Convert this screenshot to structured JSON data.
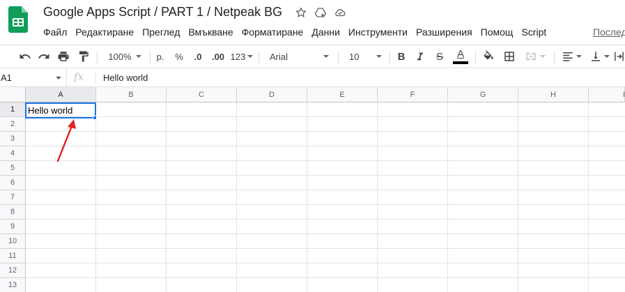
{
  "document": {
    "title": "Google Apps Script / PART 1 / Netpeak BG"
  },
  "menu": {
    "items": [
      "Файл",
      "Редактиране",
      "Преглед",
      "Вмъкване",
      "Форматиране",
      "Данни",
      "Инструменти",
      "Разширения",
      "Помощ",
      "Script"
    ],
    "last_edit": "Послед"
  },
  "toolbar": {
    "zoom": "100%",
    "currency": "р.",
    "percent": "%",
    "decrease_decimal": ".0",
    "increase_decimal": ".00",
    "more_formats": "123",
    "font": "Arial",
    "font_size": "10",
    "bold": "B",
    "strike": "S",
    "text_color": "A"
  },
  "formula_bar": {
    "name_box": "A1",
    "fx": "fx",
    "value": "Hello world"
  },
  "grid": {
    "columns": [
      "A",
      "B",
      "C",
      "D",
      "E",
      "F",
      "G",
      "H",
      "I"
    ],
    "rows": [
      "1",
      "2",
      "3",
      "4",
      "5",
      "6",
      "7",
      "8",
      "9",
      "10",
      "11",
      "12",
      "13"
    ],
    "cell_a1": "Hello world"
  },
  "colors": {
    "selection": "#1a73e8",
    "arrow": "#e02424",
    "sheets_green": "#0f9d58"
  }
}
